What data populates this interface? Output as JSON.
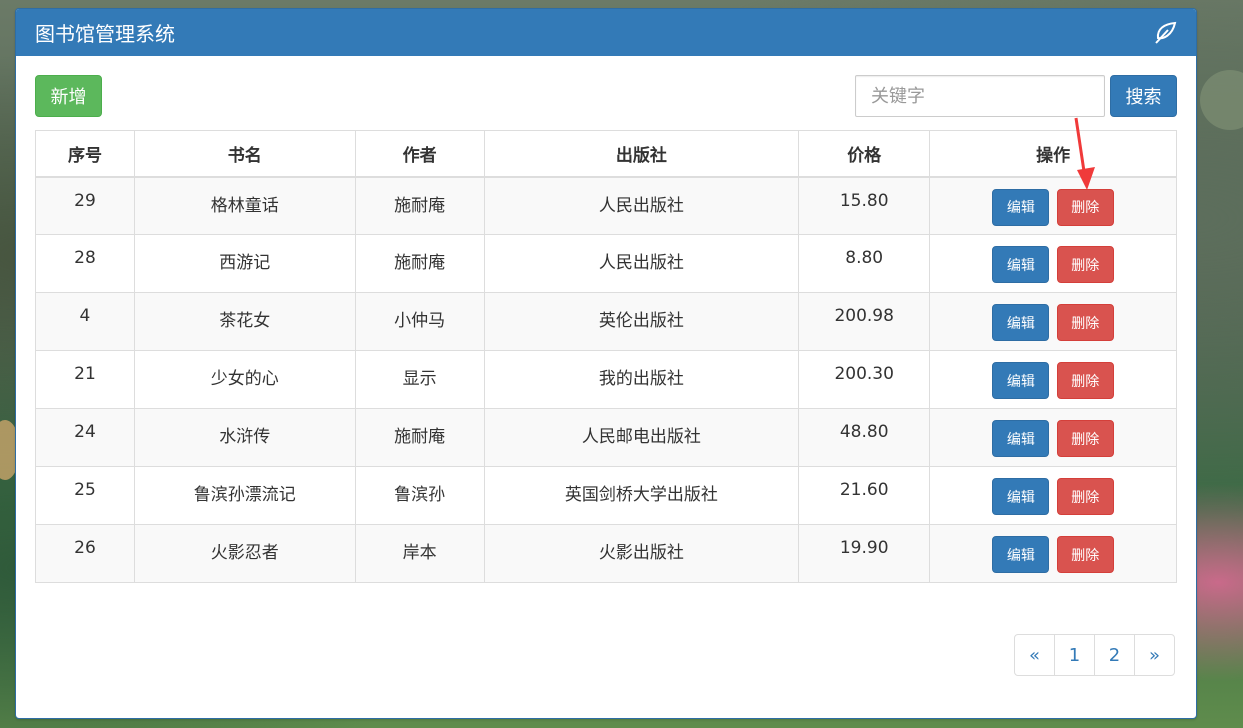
{
  "app": {
    "title": "图书馆管理系统",
    "header_icon": "leaf-icon"
  },
  "toolbar": {
    "add_label": "新增",
    "search_placeholder": "关键字",
    "search_value": "",
    "search_label": "搜索"
  },
  "table": {
    "headers": {
      "id": "序号",
      "name": "书名",
      "author": "作者",
      "publisher": "出版社",
      "price": "价格",
      "ops": "操作"
    },
    "rows": [
      {
        "id": "29",
        "name": "格林童话",
        "author": "施耐庵",
        "publisher": "人民出版社",
        "price": "15.80"
      },
      {
        "id": "28",
        "name": "西游记",
        "author": "施耐庵",
        "publisher": "人民出版社",
        "price": "8.80"
      },
      {
        "id": "4",
        "name": "茶花女",
        "author": "小仲马",
        "publisher": "英伦出版社",
        "price": "200.98"
      },
      {
        "id": "21",
        "name": "少女的心",
        "author": "显示",
        "publisher": "我的出版社",
        "price": "200.30"
      },
      {
        "id": "24",
        "name": "水浒传",
        "author": "施耐庵",
        "publisher": "人民邮电出版社",
        "price": "48.80"
      },
      {
        "id": "25",
        "name": "鲁滨孙漂流记",
        "author": "鲁滨孙",
        "publisher": "英国剑桥大学出版社",
        "price": "21.60"
      },
      {
        "id": "26",
        "name": "火影忍者",
        "author": "岸本",
        "publisher": "火影出版社",
        "price": "19.90"
      }
    ],
    "edit_label": "编辑",
    "delete_label": "删除"
  },
  "pagination": {
    "prev": "«",
    "pages": [
      "1",
      "2"
    ],
    "next": "»"
  },
  "colors": {
    "primary": "#337ab7",
    "success": "#5cb85c",
    "danger": "#d9534f",
    "annotation_arrow": "#f03a3a"
  }
}
